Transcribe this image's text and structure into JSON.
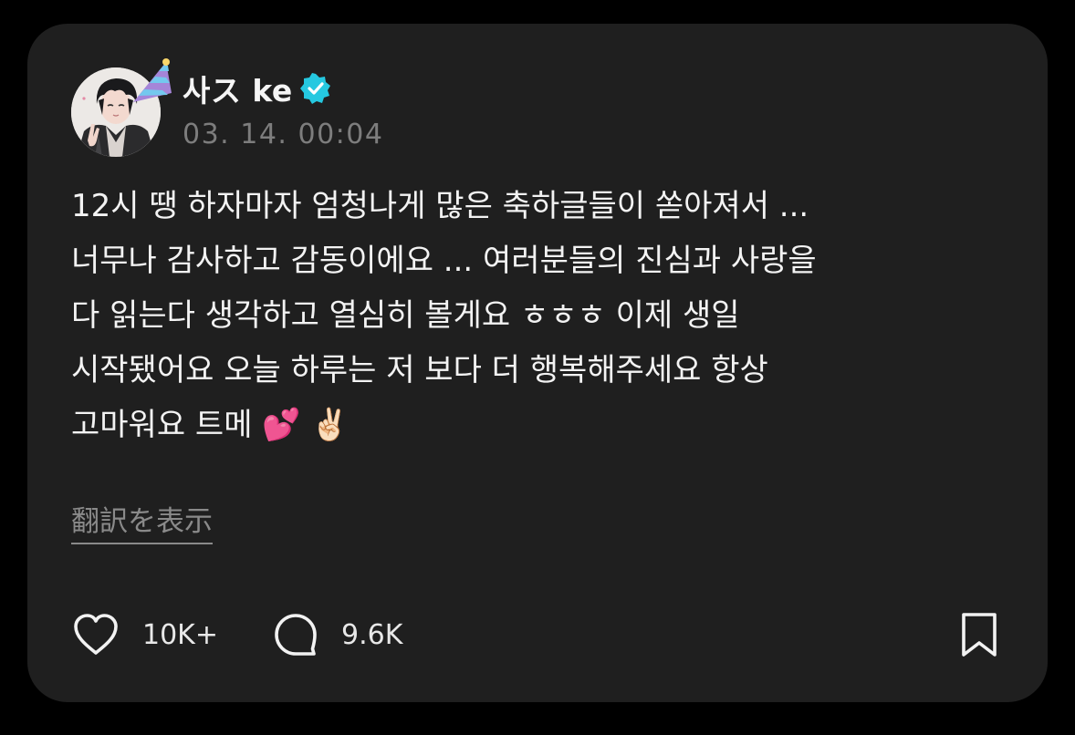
{
  "post": {
    "author": {
      "name": "사ス ke",
      "verified": true,
      "avatar": "avatar-illustration",
      "badge": "party-hat-icon",
      "verified_color": "#25c8e0"
    },
    "timestamp": "03. 14. 00:04",
    "text": "12시 땡 하자마자 엄청나게 많은 축하글들이 쏟아져서 ...\n너무나 감사하고 감동이에요 ... 여러분들의 진심과 사랑을\n다 읽는다 생각하고 열심히 볼게요 ㅎㅎㅎ 이제 생일\n시작됐어요 오늘 하루는 저 보다 더 행복해주세요 항상\n고마워요 트메 💕 ✌🏻",
    "translate_label": "翻訳を表示",
    "actions": {
      "likes": "10K+",
      "replies": "9.6K"
    },
    "icons": [
      "heart-icon",
      "comment-icon",
      "bookmark-icon"
    ]
  },
  "theme": {
    "background": "#000000",
    "card": "#1f1f1f",
    "text": "#f3f3f3",
    "muted": "#7d7d7d"
  }
}
